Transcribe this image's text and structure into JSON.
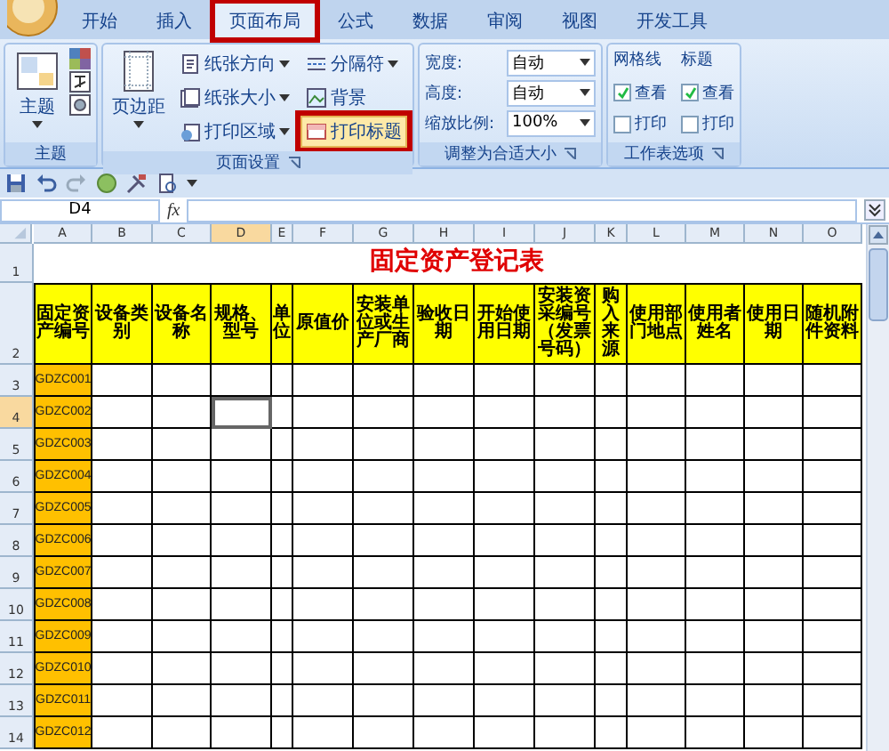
{
  "ribbon": {
    "tabs": [
      {
        "label": "开始",
        "selected": false,
        "highlighted": false
      },
      {
        "label": "插入",
        "selected": false,
        "highlighted": false
      },
      {
        "label": "页面布局",
        "selected": true,
        "highlighted": true
      },
      {
        "label": "公式",
        "selected": false,
        "highlighted": false
      },
      {
        "label": "数据",
        "selected": false,
        "highlighted": false
      },
      {
        "label": "审阅",
        "selected": false,
        "highlighted": false
      },
      {
        "label": "视图",
        "selected": false,
        "highlighted": false
      },
      {
        "label": "开发工具",
        "selected": false,
        "highlighted": false
      }
    ],
    "groups": [
      {
        "kind": "theme",
        "label": "主题",
        "button": "主题"
      },
      {
        "kind": "page_setup",
        "label": "页面设置",
        "big_button": "页边距",
        "buttons": [
          {
            "label": "纸张方向",
            "dropdown": true,
            "highlighted": false
          },
          {
            "label": "纸张大小",
            "dropdown": true,
            "highlighted": false
          },
          {
            "label": "打印区域",
            "dropdown": true,
            "highlighted": false
          },
          {
            "label": "分隔符",
            "dropdown": true,
            "highlighted": false
          },
          {
            "label": "背景",
            "dropdown": false,
            "highlighted": false
          },
          {
            "label": "打印标题",
            "dropdown": false,
            "highlighted": true
          }
        ]
      },
      {
        "kind": "scale",
        "label": "调整为合适大小",
        "fields": [
          {
            "label": "宽度:",
            "value": "自动"
          },
          {
            "label": "高度:",
            "value": "自动"
          },
          {
            "label": "缩放比例:",
            "value": "100%"
          }
        ]
      },
      {
        "kind": "sheet_options",
        "label": "工作表选项",
        "options": [
          {
            "heading": "网格线",
            "view": {
              "label": "查看",
              "checked": true
            },
            "print": {
              "label": "打印",
              "checked": false
            }
          },
          {
            "heading": "标题",
            "view": {
              "label": "查看",
              "checked": true
            },
            "print": {
              "label": "打印",
              "checked": false
            }
          }
        ]
      }
    ]
  },
  "formula_bar": {
    "name_box": "D4",
    "function_symbol": "fx"
  },
  "sheet": {
    "title_row": "1",
    "header_row": "2",
    "title": "固定资产登记表",
    "columns": [
      {
        "letter": "A",
        "header": "固定资产编号",
        "selected": false
      },
      {
        "letter": "B",
        "header": "设备类别",
        "selected": false
      },
      {
        "letter": "C",
        "header": "设备名称",
        "selected": false
      },
      {
        "letter": "D",
        "header": "规格、型号",
        "selected": true
      },
      {
        "letter": "E",
        "header": "单位",
        "selected": false
      },
      {
        "letter": "F",
        "header": "原值价",
        "selected": false
      },
      {
        "letter": "G",
        "header": "安装单位或生产厂商",
        "selected": false
      },
      {
        "letter": "H",
        "header": "验收日期",
        "selected": false
      },
      {
        "letter": "I",
        "header": "开始使用日期",
        "selected": false
      },
      {
        "letter": "J",
        "header": "安装资采编号（发票号码）",
        "selected": false
      },
      {
        "letter": "K",
        "header": "购入来源",
        "selected": false
      },
      {
        "letter": "L",
        "header": "使用部门地点",
        "selected": false
      },
      {
        "letter": "M",
        "header": "使用者姓名",
        "selected": false
      },
      {
        "letter": "N",
        "header": "使用日期",
        "selected": false
      },
      {
        "letter": "O",
        "header": "随机附件资料",
        "selected": false
      }
    ],
    "rows": [
      {
        "number": "3",
        "asset_id": "GDZC001",
        "selected": false
      },
      {
        "number": "4",
        "asset_id": "GDZC002",
        "selected": true
      },
      {
        "number": "5",
        "asset_id": "GDZC003",
        "selected": false
      },
      {
        "number": "6",
        "asset_id": "GDZC004",
        "selected": false
      },
      {
        "number": "7",
        "asset_id": "GDZC005",
        "selected": false
      },
      {
        "number": "8",
        "asset_id": "GDZC006",
        "selected": false
      },
      {
        "number": "9",
        "asset_id": "GDZC007",
        "selected": false
      },
      {
        "number": "10",
        "asset_id": "GDZC008",
        "selected": false
      },
      {
        "number": "11",
        "asset_id": "GDZC009",
        "selected": false
      },
      {
        "number": "12",
        "asset_id": "GDZC010",
        "selected": false
      },
      {
        "number": "13",
        "asset_id": "GDZC011",
        "selected": false
      },
      {
        "number": "14",
        "asset_id": "GDZC012",
        "selected": false
      }
    ]
  }
}
